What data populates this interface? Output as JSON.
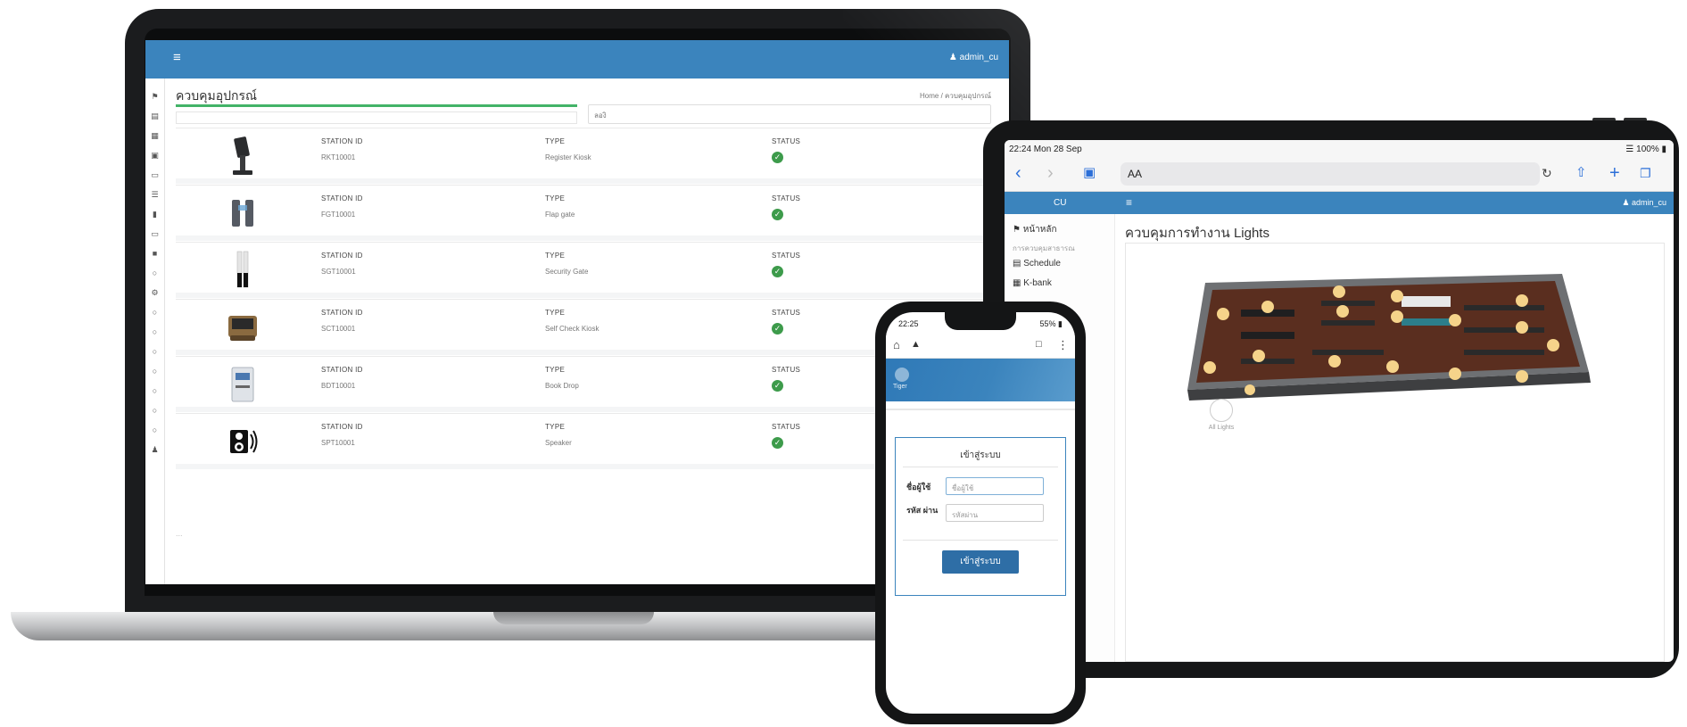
{
  "laptop": {
    "header": {
      "user": "admin_cu"
    },
    "title": "ควบคุมอุปกรณ์",
    "breadcrumb": "Home / ควบคุมอุปกรณ์",
    "search_value": "ลองิ",
    "progress_percent": 100,
    "devices": [
      {
        "station_label": "STATION ID",
        "station_id": "RKT10001",
        "type_label": "TYPE",
        "type": "Register Kiosk",
        "status_label": "STATUS",
        "status": "ok",
        "icon": "kiosk-icon"
      },
      {
        "station_label": "STATION ID",
        "station_id": "FGT10001",
        "type_label": "TYPE",
        "type": "Flap gate",
        "status_label": "STATUS",
        "status": "ok",
        "icon": "flap-gate-icon"
      },
      {
        "station_label": "STATION ID",
        "station_id": "SGT10001",
        "type_label": "TYPE",
        "type": "Security Gate",
        "status_label": "STATUS",
        "status": "ok",
        "icon": "security-gate-icon"
      },
      {
        "station_label": "STATION ID",
        "station_id": "SCT10001",
        "type_label": "TYPE",
        "type": "Self Check Kiosk",
        "status_label": "STATUS",
        "status": "ok",
        "icon": "self-check-kiosk-icon"
      },
      {
        "station_label": "STATION ID",
        "station_id": "BDT10001",
        "type_label": "TYPE",
        "type": "Book Drop",
        "status_label": "STATUS",
        "status": "ok",
        "icon": "book-drop-icon"
      },
      {
        "station_label": "STATION ID",
        "station_id": "SPT10001",
        "type_label": "TYPE",
        "type": "Speaker",
        "status_label": "STATUS",
        "status": "ok",
        "icon": "speaker-icon"
      }
    ],
    "more": "..."
  },
  "tablet": {
    "status": {
      "time": "22:24  Mon 28 Sep",
      "battery": "100%"
    },
    "address": "AA",
    "brand": "CU",
    "user": "admin_cu",
    "sidebar": [
      {
        "label": "หน้าหลัก"
      },
      {
        "label": "การควบคุมสาธารณ",
        "sub": true
      },
      {
        "label": "Schedule"
      },
      {
        "label": "K-bank"
      }
    ],
    "title": "ควบคุมการทำงาน Lights",
    "all_lights_label": "All Lights",
    "colors": {
      "floor": "#5a2e1f",
      "wall": "#6e7073",
      "light": "#f5d38a"
    }
  },
  "phone": {
    "status": {
      "time": "22:25",
      "signal": "55%"
    },
    "logo_text": "Tiger",
    "login_title": "เข้าสู่ระบบ",
    "username_label": "ชื่อผู้ใช้",
    "username_placeholder": "ชื่อผู้ใช้",
    "password_label": "รหัส ผ่าน",
    "password_placeholder": "รหัสผ่าน",
    "login_button": "เข้าสู่ระบบ"
  }
}
